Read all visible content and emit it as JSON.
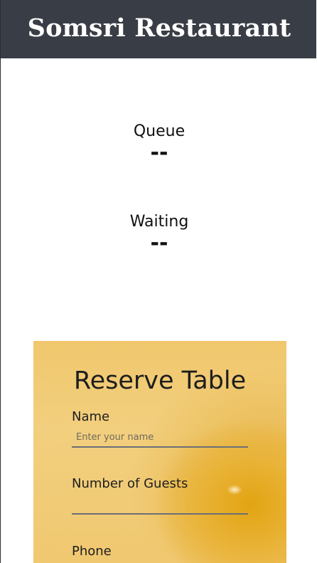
{
  "header": {
    "title": "Somsri Restaurant"
  },
  "stats": {
    "queue": {
      "label": "Queue",
      "value": "--"
    },
    "waiting": {
      "label": "Waiting",
      "value": "--"
    }
  },
  "reserve": {
    "title": "Reserve Table",
    "fields": {
      "name": {
        "label": "Name",
        "placeholder": "Enter your name",
        "value": ""
      },
      "guests": {
        "label": "Number of Guests",
        "placeholder": "",
        "value": ""
      },
      "phone": {
        "label": "Phone",
        "placeholder": "",
        "value": ""
      }
    }
  },
  "colors": {
    "header_bg": "#393d45",
    "card_bg": "#f0c76d",
    "input_underline": "#6b6f78"
  }
}
